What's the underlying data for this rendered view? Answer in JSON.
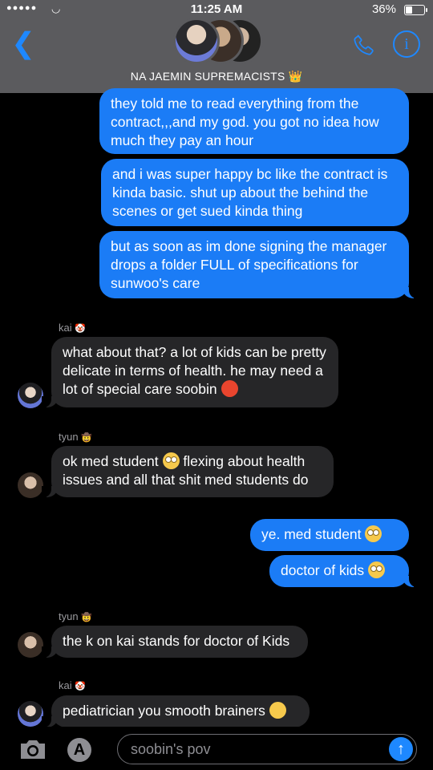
{
  "status_bar": {
    "signal": "●●●●●",
    "time": "11:25 AM",
    "battery_pct": "36%",
    "battery_level": 0.36
  },
  "header": {
    "group_name": "NA JAEMIN SUPREMACISTS 👑",
    "back_icon": "chevron-left-icon",
    "call_icon": "phone-icon",
    "info_icon": "info-icon"
  },
  "messages": [
    {
      "dir": "out",
      "text": "they told me to read everything from the contract,,,and my god. you got no idea how much they pay an hour"
    },
    {
      "dir": "out",
      "text": "and i was super happy bc like the contract is kinda basic. shut up about the behind the scenes or get sued kinda thing"
    },
    {
      "dir": "out",
      "text": "but as soon as im done signing the manager drops a folder FULL of specifications for sunwoo's care"
    },
    {
      "dir": "in",
      "sender": "kai",
      "sender_emoji": "🤡",
      "text": "what about that? a lot of kids can be pretty delicate in terms of health. he may need a lot of special care soobin",
      "emoji": "😡"
    },
    {
      "dir": "in",
      "sender": "tyun",
      "sender_emoji": "🤠",
      "text_before": "ok med student",
      "emoji": "🙄",
      "text": "flexing about health issues and all that shit med students do"
    },
    {
      "dir": "out",
      "text": "ye. med student",
      "emoji": "🙄"
    },
    {
      "dir": "out",
      "text": "doctor of kids",
      "emoji": "🙄"
    },
    {
      "dir": "in",
      "sender": "tyun",
      "sender_emoji": "🤠",
      "text": "the k on kai stands for doctor of Kids"
    },
    {
      "dir": "in",
      "sender": "kai",
      "sender_emoji": "🤡",
      "text": "pediatrician you smooth brainers",
      "emoji": "😒"
    }
  ],
  "composer": {
    "camera_icon": "camera-icon",
    "apps_icon": "app-store-icon",
    "text": "soobin's pov",
    "send_icon": "arrow-up-icon"
  }
}
